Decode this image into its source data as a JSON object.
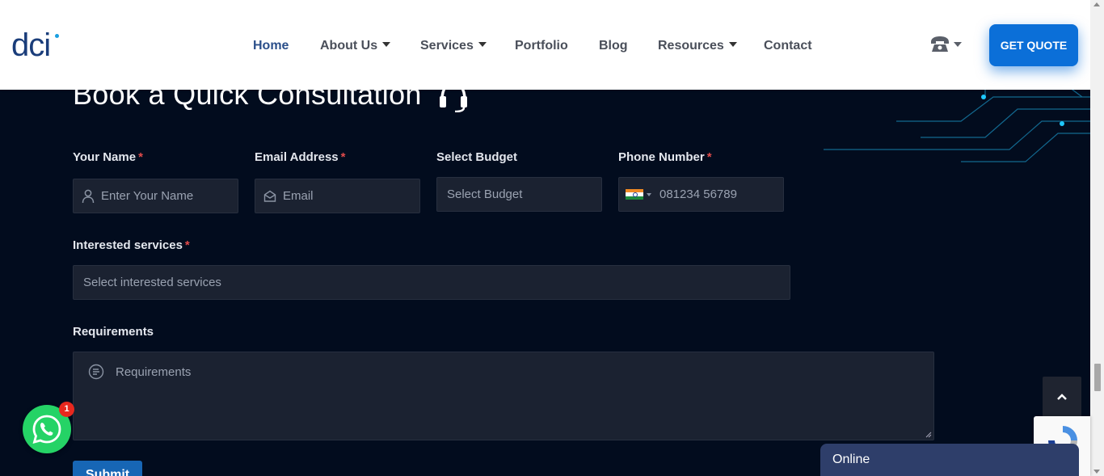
{
  "header": {
    "logo_text": "dci",
    "nav": [
      {
        "label": "Home",
        "active": true,
        "dropdown": false
      },
      {
        "label": "About Us",
        "active": false,
        "dropdown": true
      },
      {
        "label": "Services",
        "active": false,
        "dropdown": true
      },
      {
        "label": "Portfolio",
        "active": false,
        "dropdown": false
      },
      {
        "label": "Blog",
        "active": false,
        "dropdown": false
      },
      {
        "label": "Resources",
        "active": false,
        "dropdown": true
      },
      {
        "label": "Contact",
        "active": false,
        "dropdown": false
      }
    ],
    "phone_icon": "phone-icon",
    "quote_label": "GET QUOTE"
  },
  "form": {
    "title": "Book a Quick Consultation",
    "title_icon": "headset-icon",
    "name": {
      "label": "Your Name",
      "required": "*",
      "placeholder": "Enter Your Name",
      "icon": "user-icon"
    },
    "email": {
      "label": "Email Address",
      "required": "*",
      "placeholder": "Email",
      "icon": "envelope-icon"
    },
    "budget": {
      "label": "Select Budget",
      "placeholder": "Select Budget"
    },
    "phone": {
      "label": "Phone Number",
      "required": "*",
      "placeholder": "081234 56789",
      "flag": "india-flag-icon"
    },
    "services": {
      "label": "Interested services",
      "required": "*",
      "placeholder": "Select interested services"
    },
    "requirements": {
      "label": "Requirements",
      "placeholder": "Requirements",
      "icon": "note-icon"
    },
    "submit_label": "Submit"
  },
  "widgets": {
    "chat_status": "Online",
    "whatsapp_badge": "1",
    "back_to_top_icon": "chevron-up-icon"
  },
  "colors": {
    "background": "#020c1e",
    "field": "#1b2231",
    "accent": "#0b6fd8",
    "chat": "#2e3e6a",
    "whatsapp": "#25d366"
  }
}
